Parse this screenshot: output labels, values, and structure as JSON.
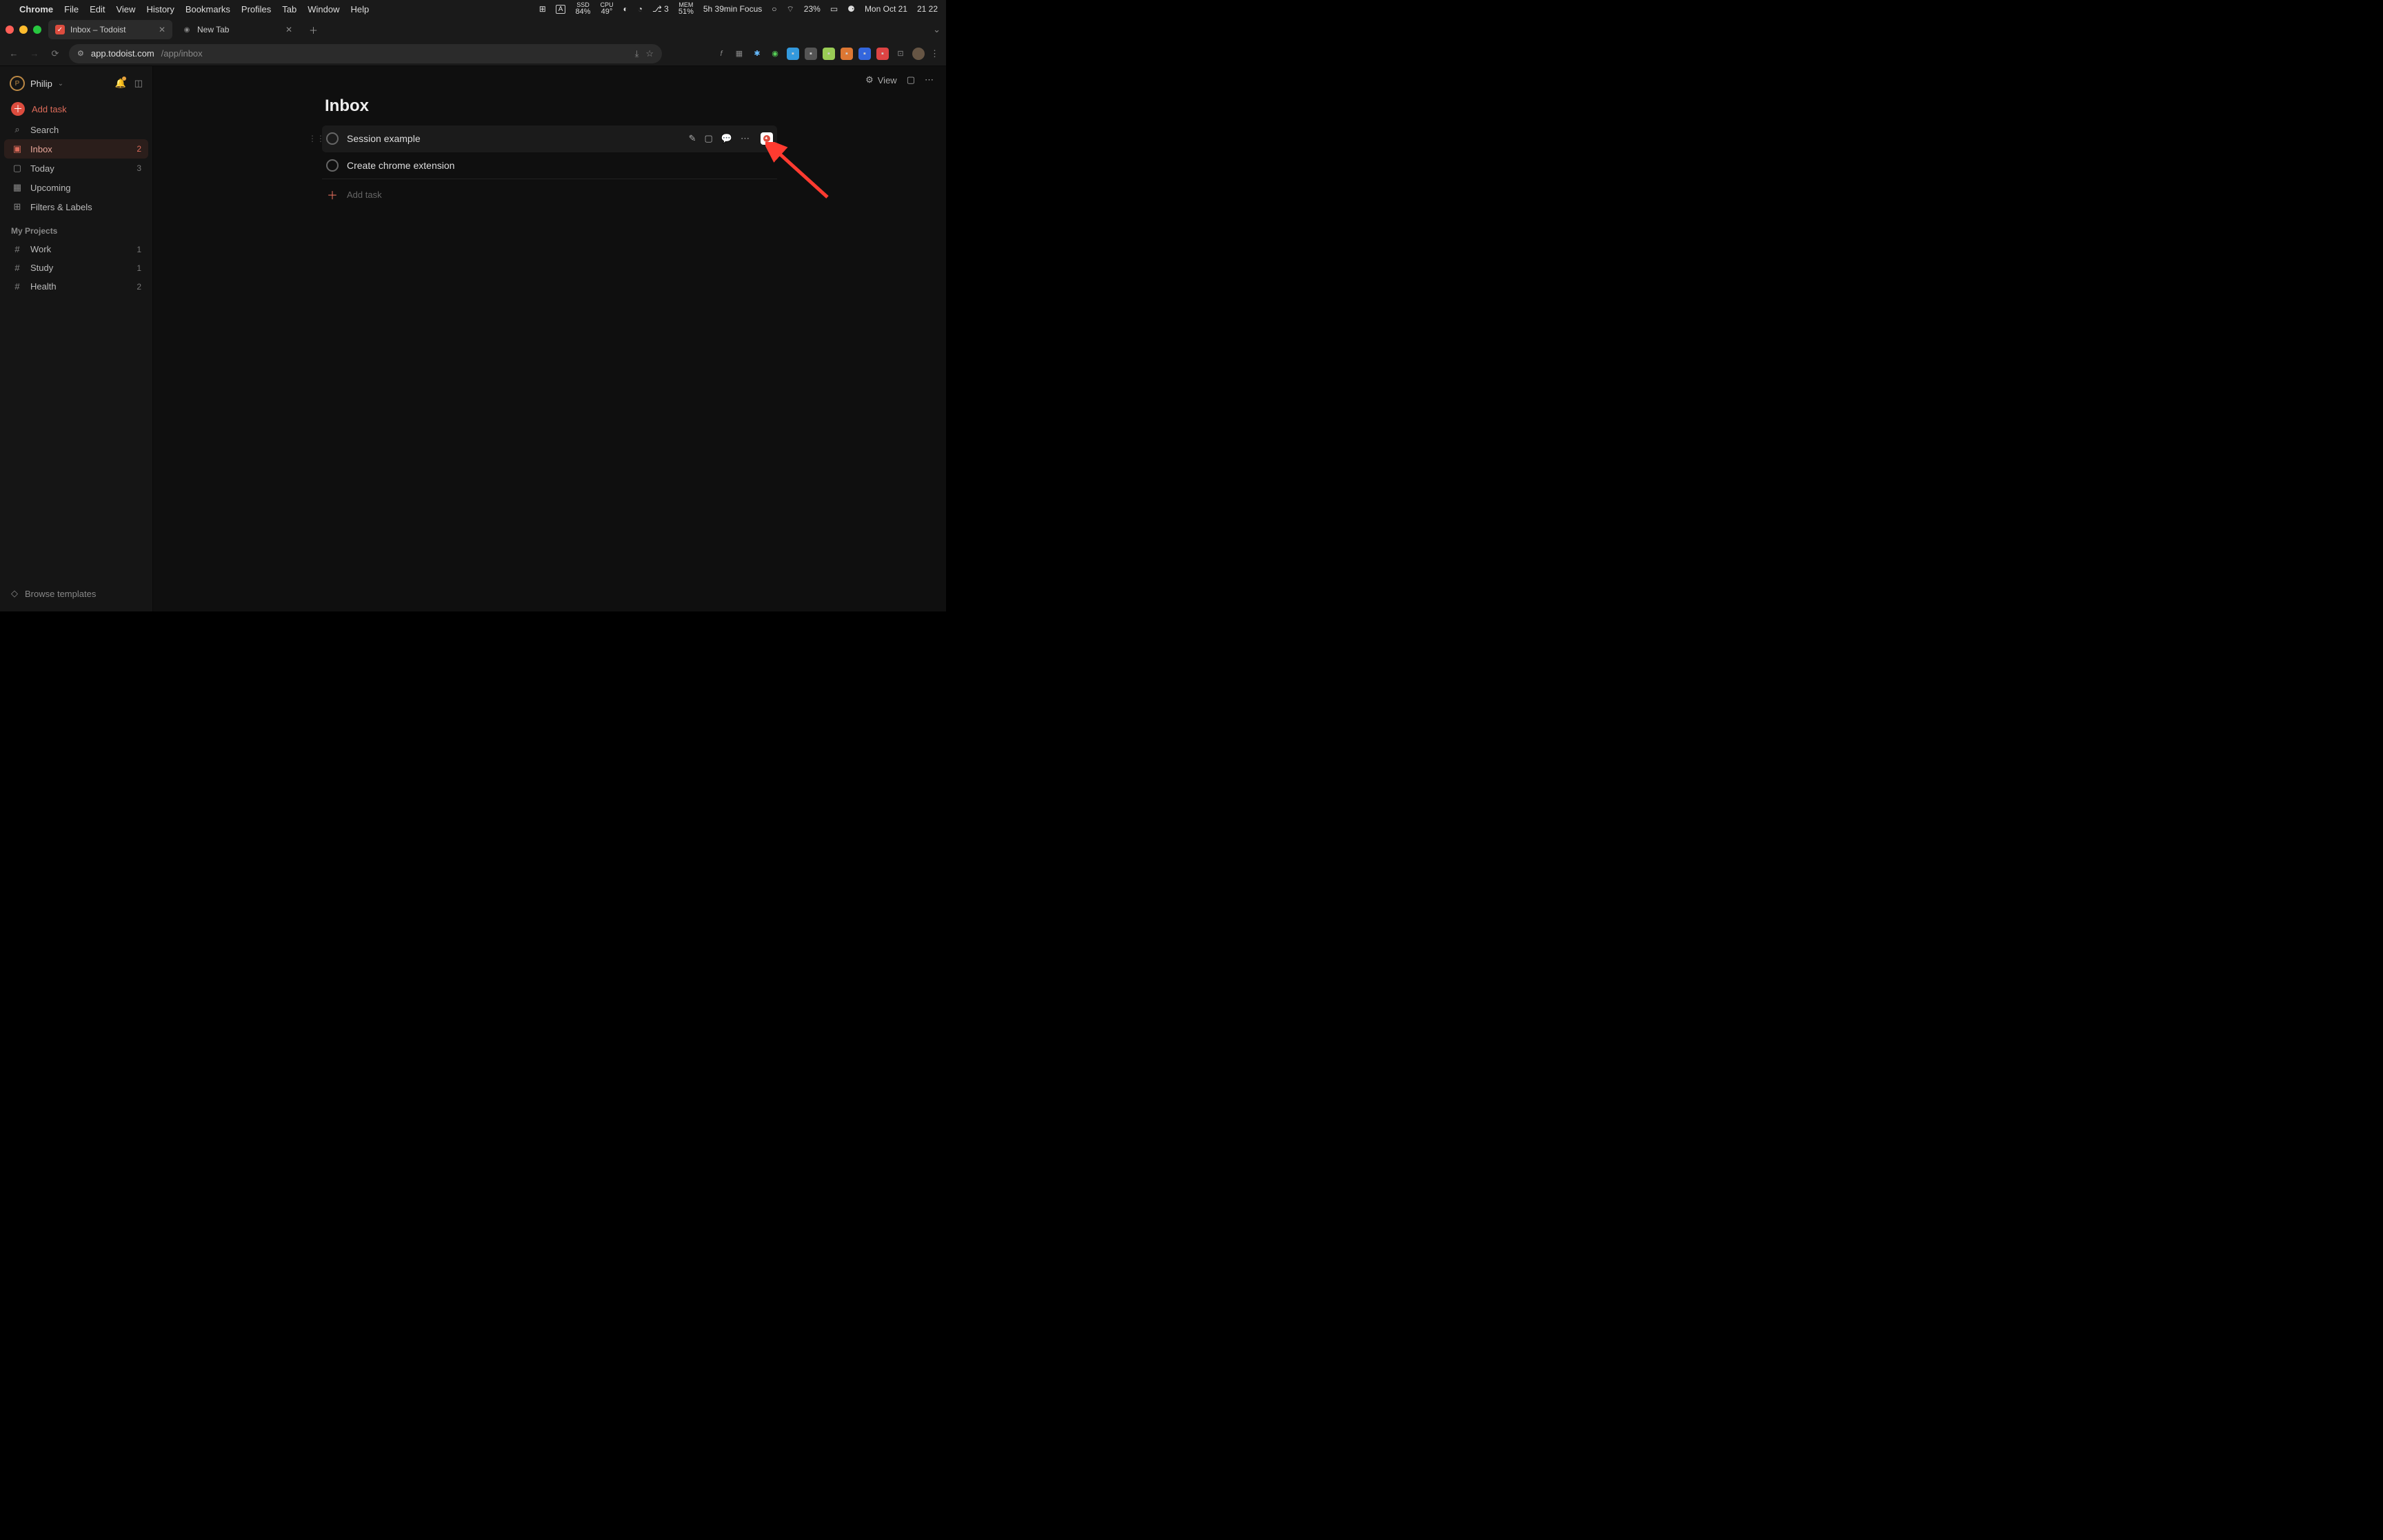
{
  "menubar": {
    "app": "Chrome",
    "items": [
      "File",
      "Edit",
      "View",
      "History",
      "Bookmarks",
      "Profiles",
      "Tab",
      "Window",
      "Help"
    ],
    "ssd_label": "SSD",
    "ssd": "84%",
    "cpu_label": "CPU",
    "cpu": "49°",
    "mem_label": "MEM",
    "mem": "51%",
    "git": "3",
    "focus": "5h 39min Focus",
    "battery": "23%",
    "date": "Mon Oct 21",
    "time": "21 22"
  },
  "tabs": {
    "active": {
      "title": "Inbox – Todoist"
    },
    "other": {
      "title": "New Tab"
    }
  },
  "url": {
    "host": "app.todoist.com",
    "path": "/app/inbox"
  },
  "sidebar": {
    "user": "Philip",
    "addtask": "Add task",
    "items": [
      {
        "icon": "search",
        "label": "Search",
        "count": ""
      },
      {
        "icon": "inbox",
        "label": "Inbox",
        "count": "2",
        "active": true
      },
      {
        "icon": "today",
        "label": "Today",
        "count": "3"
      },
      {
        "icon": "upcoming",
        "label": "Upcoming",
        "count": ""
      },
      {
        "icon": "filters",
        "label": "Filters & Labels",
        "count": ""
      }
    ],
    "projects_header": "My Projects",
    "projects": [
      {
        "label": "Work",
        "count": "1"
      },
      {
        "label": "Study",
        "count": "1"
      },
      {
        "label": "Health",
        "count": "2"
      }
    ],
    "footer": "Browse templates"
  },
  "main": {
    "viewLabel": "View",
    "title": "Inbox",
    "tasks": [
      {
        "title": "Session example",
        "hovered": true
      },
      {
        "title": "Create chrome extension",
        "hovered": false
      }
    ],
    "addtask": "Add task"
  }
}
